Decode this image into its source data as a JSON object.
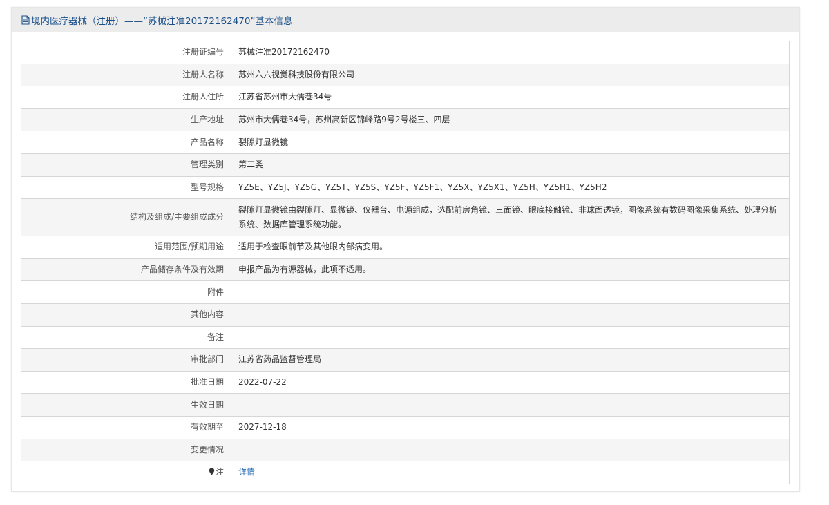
{
  "header": {
    "title": "境内医疗器械（注册）——“苏械注准20172162470”基本信息",
    "icon": "document-icon"
  },
  "rows": [
    {
      "label": "注册证编号",
      "value": "苏械注准20172162470"
    },
    {
      "label": "注册人名称",
      "value": "苏州六六视觉科技股份有限公司"
    },
    {
      "label": "注册人住所",
      "value": "江苏省苏州市大儒巷34号"
    },
    {
      "label": "生产地址",
      "value": "苏州市大儒巷34号，苏州高新区锦峰路9号2号楼三、四层"
    },
    {
      "label": "产品名称",
      "value": "裂隙灯显微镜"
    },
    {
      "label": "管理类别",
      "value": "第二类"
    },
    {
      "label": "型号规格",
      "value": "YZ5E、YZ5J、YZ5G、YZ5T、YZ5S、YZ5F、YZ5F1、YZ5X、YZ5X1、YZ5H、YZ5H1、YZ5H2"
    },
    {
      "label": "结构及组成/主要组成成分",
      "value": "裂隙灯显微镜由裂隙灯、显微镜、仪器台、电源组成，选配前房角镜、三面镜、眼底接触镜、非球面透镜，图像系统有数码图像采集系统、处理分析系统、数据库管理系统功能。"
    },
    {
      "label": "适用范围/预期用途",
      "value": "适用于检查眼前节及其他眼内部病变用。"
    },
    {
      "label": "产品储存条件及有效期",
      "value": "申报产品为有源器械，此项不适用。"
    },
    {
      "label": "附件",
      "value": ""
    },
    {
      "label": "其他内容",
      "value": ""
    },
    {
      "label": "备注",
      "value": ""
    },
    {
      "label": "审批部门",
      "value": "江苏省药品监督管理局"
    },
    {
      "label": "批准日期",
      "value": "2022-07-22"
    },
    {
      "label": "生效日期",
      "value": ""
    },
    {
      "label": "有效期至",
      "value": "2027-12-18"
    },
    {
      "label": "变更情况",
      "value": ""
    }
  ],
  "note_row": {
    "label": "注",
    "icon": "pin-icon",
    "link_text": "详情"
  },
  "colors": {
    "header_text": "#1a4f8a",
    "link": "#2a6fb6",
    "border": "#d6d6d6",
    "stripe": "#f5f5f5"
  }
}
